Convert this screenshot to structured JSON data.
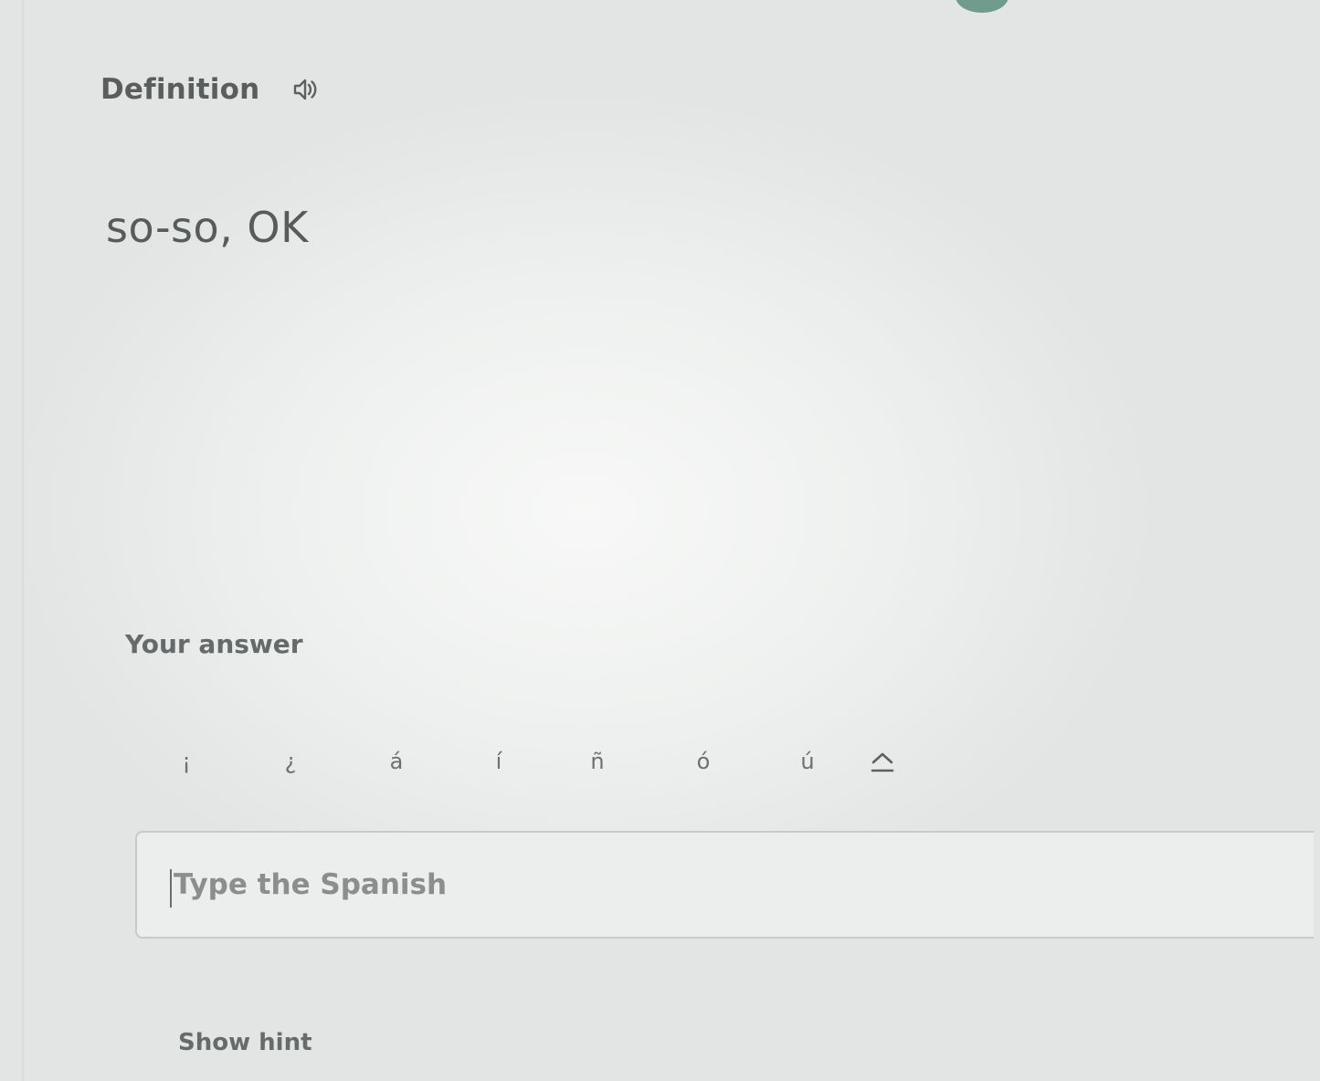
{
  "question": {
    "section_label": "Definition",
    "definition": "so-so, OK"
  },
  "answer": {
    "label": "Your answer",
    "placeholder": "Type the Spanish",
    "value": ""
  },
  "accent_keys": [
    "¡",
    "¿",
    "á",
    "í",
    "ñ",
    "ó",
    "ú"
  ],
  "hint": {
    "label": "Show hint"
  },
  "colors": {
    "accent_dot": "#6f9c8c",
    "text": "#5a5d5d",
    "border": "#c6cac9"
  },
  "icons": {
    "audio": "speaker-icon",
    "shift": "caret-up-icon"
  }
}
